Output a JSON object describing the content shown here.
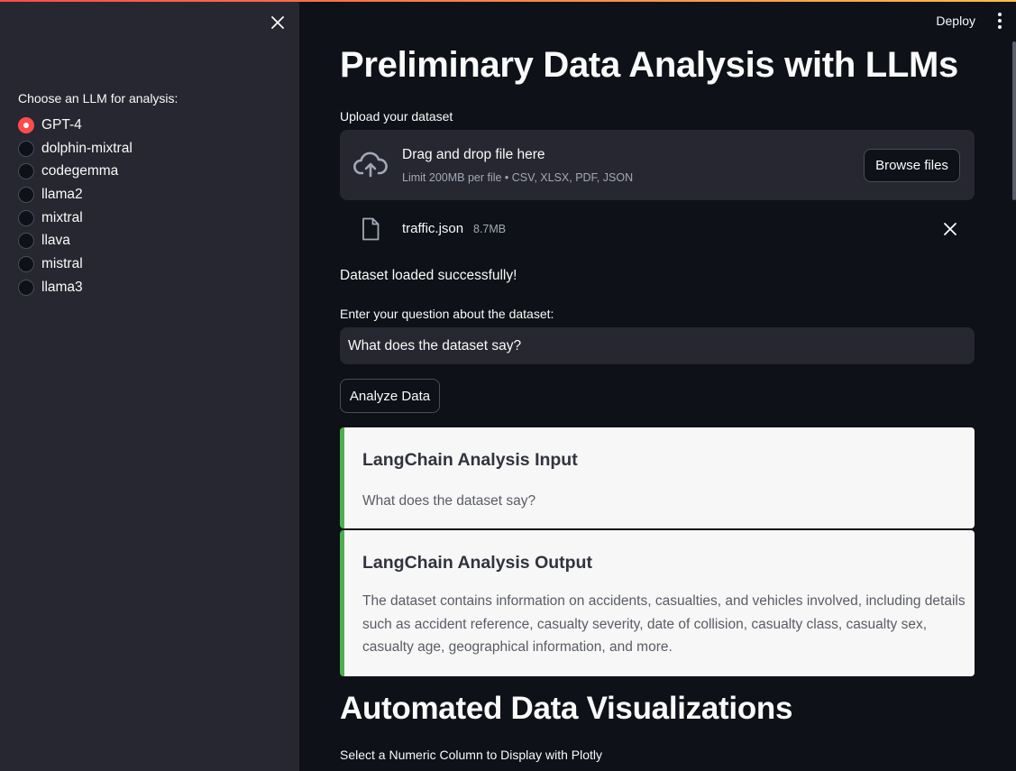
{
  "sidebar": {
    "radio_label": "Choose an LLM for analysis:",
    "options": [
      {
        "label": "GPT-4",
        "selected": true
      },
      {
        "label": "dolphin-mixtral",
        "selected": false
      },
      {
        "label": "codegemma",
        "selected": false
      },
      {
        "label": "llama2",
        "selected": false
      },
      {
        "label": "mixtral",
        "selected": false
      },
      {
        "label": "llava",
        "selected": false
      },
      {
        "label": "mistral",
        "selected": false
      },
      {
        "label": "llama3",
        "selected": false
      }
    ]
  },
  "header": {
    "deploy_label": "Deploy"
  },
  "main": {
    "title": "Preliminary Data Analysis with LLMs",
    "upload": {
      "label": "Upload your dataset",
      "drop_title": "Drag and drop file here",
      "drop_subtitle": "Limit 200MB per file • CSV, XLSX, PDF, JSON",
      "browse_label": "Browse files",
      "file_name": "traffic.json",
      "file_size": "8.7MB"
    },
    "success_message": "Dataset loaded successfully!",
    "question": {
      "label": "Enter your question about the dataset:",
      "value": "What does the dataset say?"
    },
    "analyze_label": "Analyze Data",
    "input_card": {
      "title": "LangChain Analysis Input",
      "body": "What does the dataset say?"
    },
    "output_card": {
      "title": "LangChain Analysis Output",
      "body": "The dataset contains information on accidents, casualties, and vehicles involved, including details such as accident reference, casualty severity, date of collision, casualty class, casualty sex, casualty age, geographical information, and more."
    },
    "viz_title": "Automated Data Visualizations",
    "select_label": "Select a Numeric Column to Display with Plotly"
  },
  "colors": {
    "accent": "#ff4b4b",
    "card_border": "#4caf50",
    "sidebar_bg": "#262730",
    "main_bg": "#0e1117"
  }
}
